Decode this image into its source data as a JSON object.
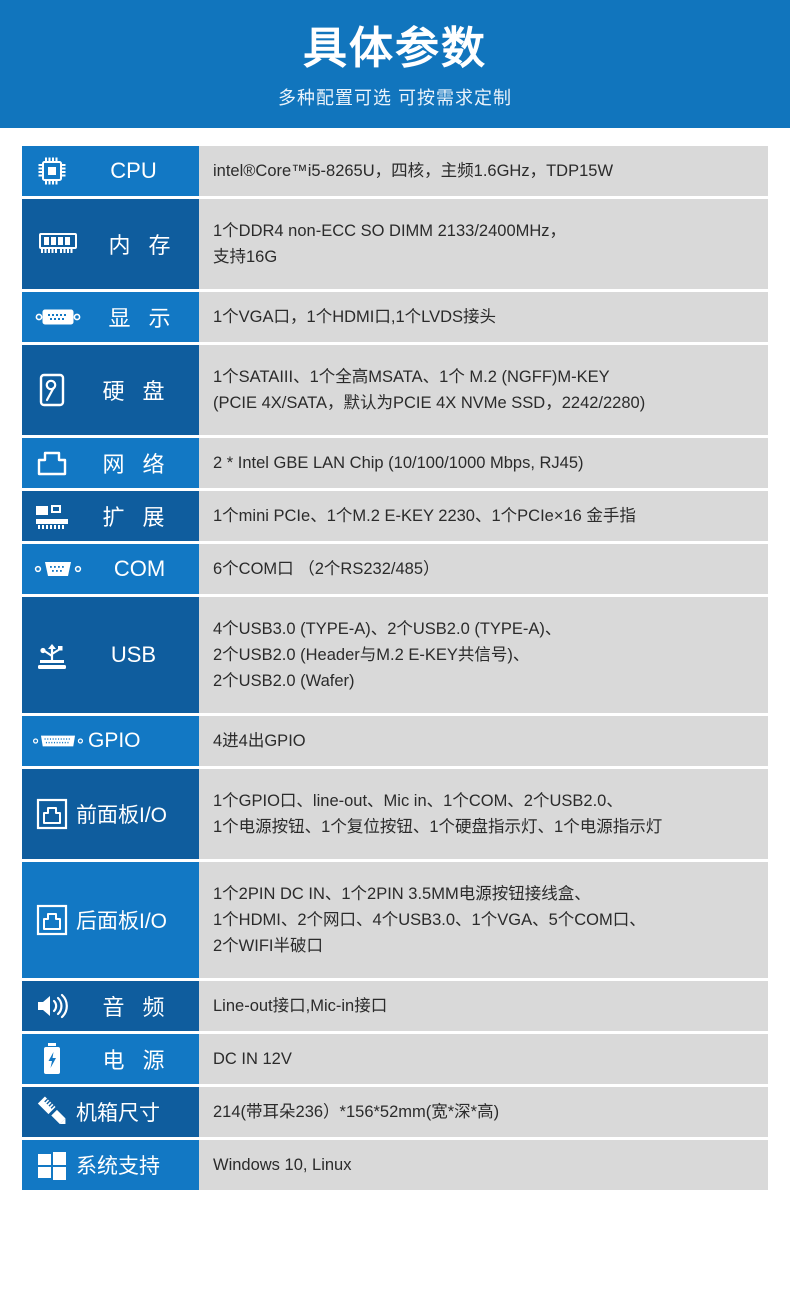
{
  "banner": {
    "title": "具体参数",
    "subtitle": "多种配置可选 可按需求定制",
    "bg_color": "#1175bd"
  },
  "colors": {
    "label_light": "#1278c4",
    "label_dark": "#0f5d9e",
    "value_bg": "#d9d9d9",
    "value_text": "#2b2b2b"
  },
  "specs": [
    {
      "icon": "cpu-chip-icon",
      "label": "CPU",
      "shade": "light",
      "lines": [
        "intel®Core™i5-8265U，四核，主频1.6GHz，TDP15W"
      ]
    },
    {
      "icon": "memory-module-icon",
      "label": "内 存",
      "shade": "dark",
      "lines": [
        "1个DDR4 non-ECC SO DIMM 2133/2400MHz，",
        "支持16G"
      ]
    },
    {
      "icon": "vga-port-icon",
      "label": "显 示",
      "shade": "light",
      "lines": [
        "1个VGA口，1个HDMI口,1个LVDS接头"
      ]
    },
    {
      "icon": "hard-disk-icon",
      "label": "硬 盘",
      "shade": "dark",
      "lines": [
        "1个SATAIII、1个全高MSATA、1个 M.2 (NGFF)M-KEY",
        "(PCIE 4X/SATA，默认为PCIE 4X NVMe SSD，2242/2280)"
      ]
    },
    {
      "icon": "rj45-network-icon",
      "label": "网 络",
      "shade": "light",
      "lines": [
        "2 * Intel GBE LAN Chip (10/100/1000 Mbps, RJ45)"
      ]
    },
    {
      "icon": "expansion-card-icon",
      "label": "扩 展",
      "shade": "dark",
      "lines": [
        "1个mini PCIe、1个M.2 E-KEY 2230、1个PCIe×16 金手指"
      ]
    },
    {
      "icon": "com-serial-port-icon",
      "label": "COM",
      "shade": "light",
      "lines": [
        "6个COM口 （2个RS232/485）"
      ]
    },
    {
      "icon": "usb-icon",
      "label": "USB",
      "shade": "dark",
      "lines": [
        "4个USB3.0 (TYPE-A)、2个USB2.0 (TYPE-A)、",
        "2个USB2.0 (Header与M.2 E-KEY共信号)、",
        "2个USB2.0 (Wafer)"
      ]
    },
    {
      "icon": "gpio-connector-icon",
      "label": "GPIO",
      "shade": "light",
      "lines": [
        "4进4出GPIO"
      ]
    },
    {
      "icon": "front-panel-icon",
      "label": "前面板I/O",
      "shade": "dark",
      "lines": [
        "1个GPIO口、line-out、Mic in、1个COM、2个USB2.0、",
        "1个电源按钮、1个复位按钮、1个硬盘指示灯、1个电源指示灯"
      ]
    },
    {
      "icon": "rear-panel-icon",
      "label": "后面板I/O",
      "shade": "light",
      "lines": [
        "1个2PIN DC IN、1个2PIN 3.5MM电源按钮接线盒、",
        "1个HDMI、2个网口、4个USB3.0、1个VGA、5个COM口、",
        "2个WIFI半破口"
      ]
    },
    {
      "icon": "speaker-audio-icon",
      "label": "音 频",
      "shade": "dark",
      "lines": [
        "Line-out接口,Mic-in接口"
      ]
    },
    {
      "icon": "battery-power-icon",
      "label": "电 源",
      "shade": "light",
      "lines": [
        "DC IN 12V"
      ]
    },
    {
      "icon": "ruler-pencil-icon",
      "label": "机箱尺寸",
      "shade": "dark",
      "lines": [
        "214(带耳朵236）*156*52mm(宽*深*高)"
      ]
    },
    {
      "icon": "windows-logo-icon",
      "label": "系统支持",
      "shade": "light",
      "lines": [
        "Windows 10, Linux"
      ]
    }
  ]
}
